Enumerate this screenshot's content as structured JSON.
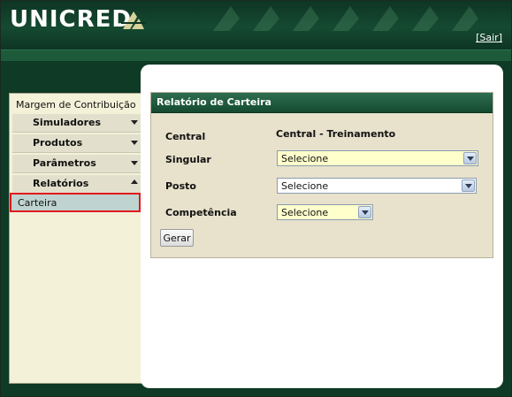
{
  "header": {
    "logo_text_uni": "UNI",
    "logo_text_cred": "CRED",
    "sair_label": "[Sair]"
  },
  "sidebar": {
    "title": "Margem de Contribuição",
    "items": [
      {
        "label": "Simuladores",
        "state": "collapsed"
      },
      {
        "label": "Produtos",
        "state": "collapsed"
      },
      {
        "label": "Parâmetros",
        "state": "collapsed"
      },
      {
        "label": "Relatórios",
        "state": "expanded"
      }
    ],
    "active_subitem": "Carteira"
  },
  "panel": {
    "title": "Relatório de Carteira",
    "fields": {
      "central_label": "Central",
      "central_value": "Central - Treinamento",
      "singular_label": "Singular",
      "singular_value": "Selecione",
      "posto_label": "Posto",
      "posto_value": "Selecione",
      "competencia_label": "Competência",
      "competencia_value": "Selecione"
    },
    "gerar_label": "Gerar"
  },
  "colors": {
    "header_green": "#0e3524",
    "highlight_red": "#e0191f",
    "selected_item_bg": "#bfd4d0",
    "select_yellow": "#ffffcc"
  }
}
